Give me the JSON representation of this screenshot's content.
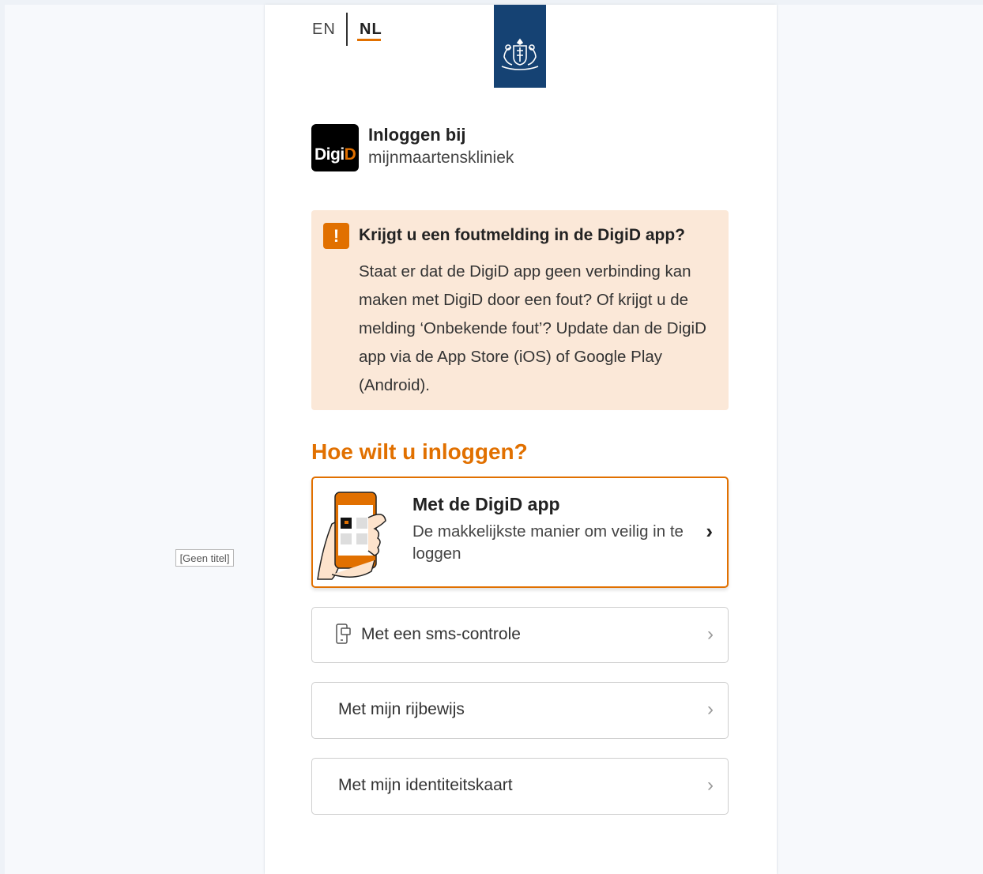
{
  "side_label": "[Geen titel]",
  "language": {
    "en": "EN",
    "nl": "NL",
    "active": "NL"
  },
  "login_header": {
    "badge_digi": "Digi",
    "badge_d": "D",
    "title": "Inloggen bij",
    "organization": "mijnmaartenskliniek"
  },
  "alert": {
    "icon": "!",
    "title": "Krijgt u een foutmelding in de DigiD app?",
    "body": "Staat er dat de DigiD app geen verbinding kan maken met DigiD door een fout? Of krijgt u de melding ‘Onbekende fout’? Update dan de DigiD app via de App Store (iOS) of Google Play (Android)."
  },
  "heading": "Hoe wilt u inloggen?",
  "options": {
    "app": {
      "title": "Met de DigiD app",
      "description": "De makkelijkste manier om veilig in te loggen"
    },
    "sms": {
      "label": "Met een sms-controle"
    },
    "rijbewijs": {
      "label": "Met mijn rijbewijs"
    },
    "id": {
      "label": "Met mijn identiteitskaart"
    }
  },
  "colors": {
    "accent": "#e17000",
    "rijk_blue": "#154273",
    "alert_bg": "#fbe8d8"
  }
}
